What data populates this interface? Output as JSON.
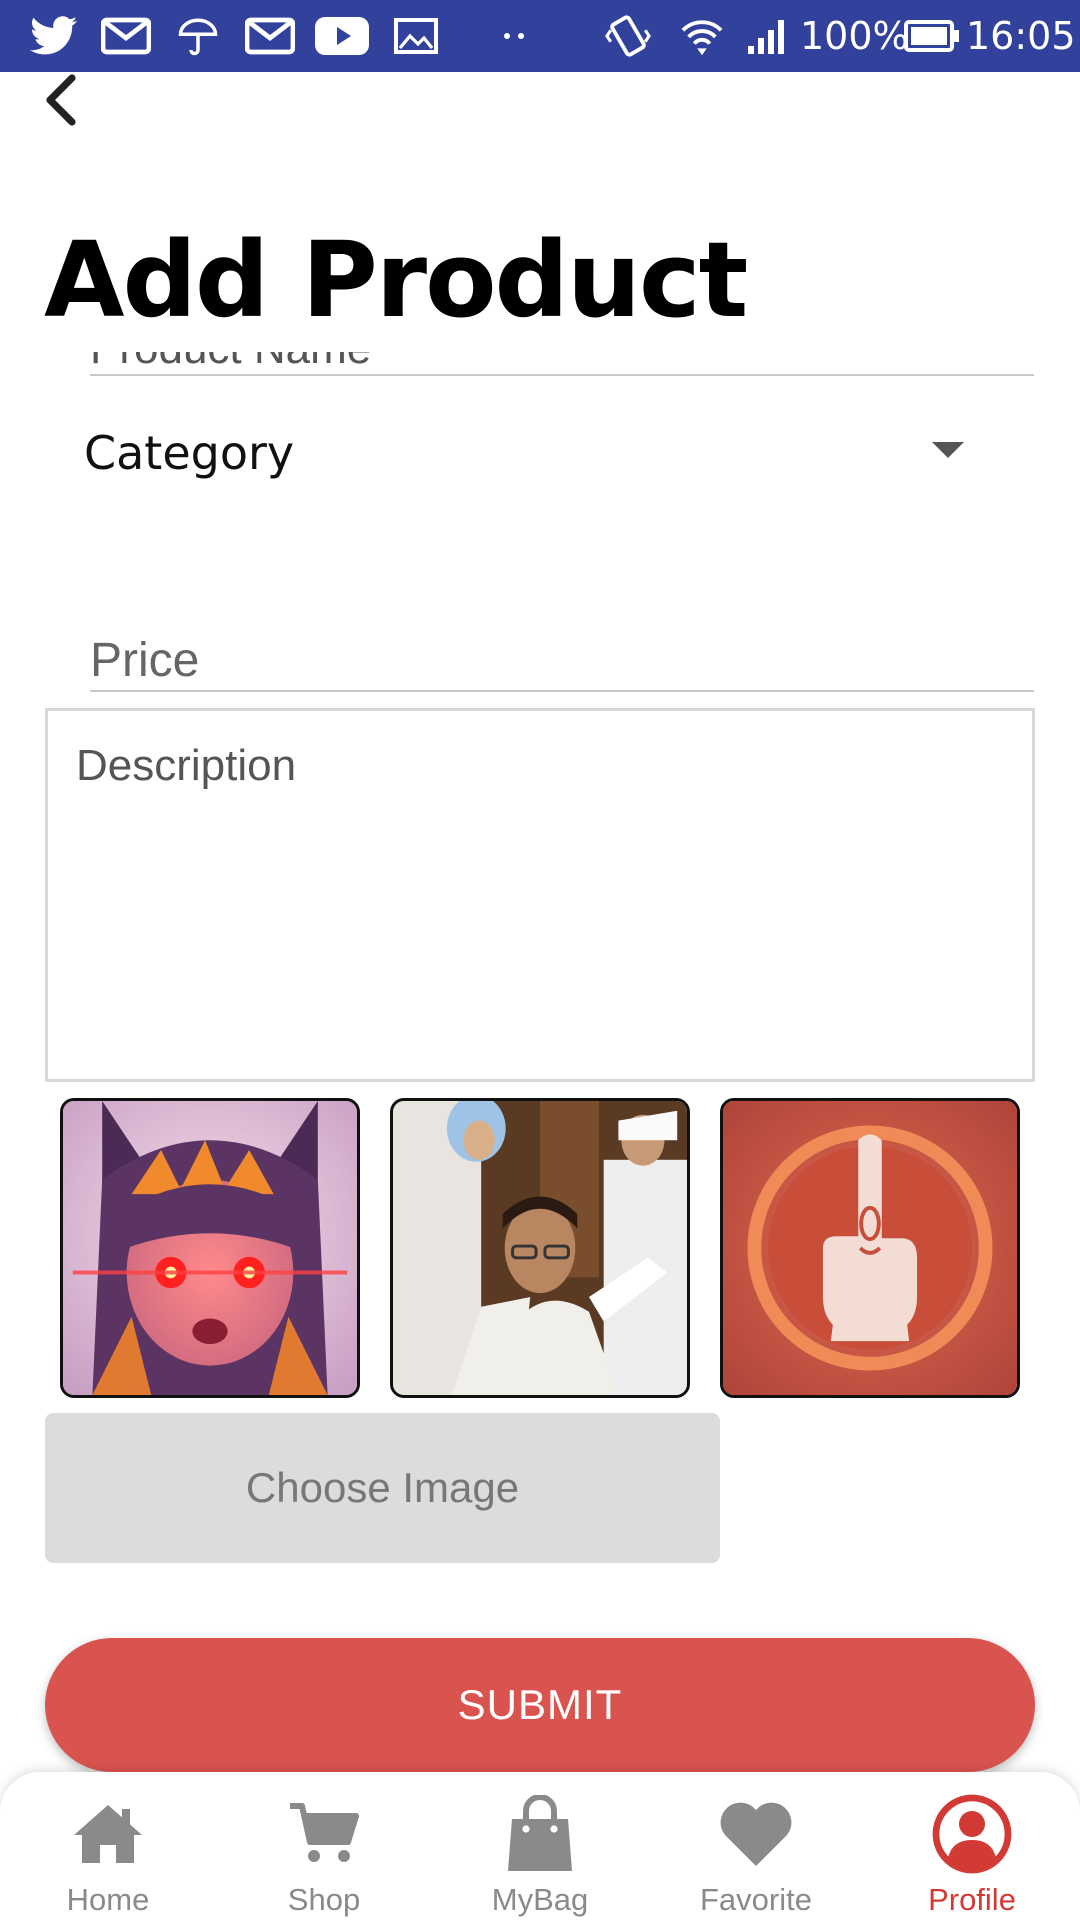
{
  "status_bar": {
    "battery": "100%",
    "time": "16:05",
    "background_color": "#32419b",
    "icons": [
      "twitter-icon",
      "gmail-icon",
      "umbrella-icon",
      "gmail-icon",
      "youtube-icon",
      "gallery-icon",
      "more-dots-icon",
      "vibrate-icon",
      "wifi-icon",
      "signal-icon",
      "battery-icon"
    ]
  },
  "header": {
    "back_icon": "chevron-left-icon",
    "title": "Add Product"
  },
  "form": {
    "product_name_placeholder": "Product Name",
    "category_label": "Category",
    "category_icon": "caret-down-icon",
    "price_placeholder": "Price",
    "description_placeholder": "Description",
    "images": [
      {
        "name": "anime-girl-glowing-eyes-image"
      },
      {
        "name": "man-receiving-injection-image"
      },
      {
        "name": "middle-finger-emblem-image"
      }
    ],
    "choose_image_label": "Choose Image",
    "submit_label": "SUBMIT",
    "submit_color": "#d9534f"
  },
  "bottom_nav": {
    "items": [
      {
        "label": "Home",
        "icon": "home-icon",
        "active": false
      },
      {
        "label": "Shop",
        "icon": "cart-icon",
        "active": false
      },
      {
        "label": "MyBag",
        "icon": "bag-icon",
        "active": false
      },
      {
        "label": "Favorite",
        "icon": "heart-icon",
        "active": false
      },
      {
        "label": "Profile",
        "icon": "profile-icon",
        "active": true
      }
    ],
    "active_color": "#d23a36",
    "inactive_color": "#8a8a8a"
  }
}
